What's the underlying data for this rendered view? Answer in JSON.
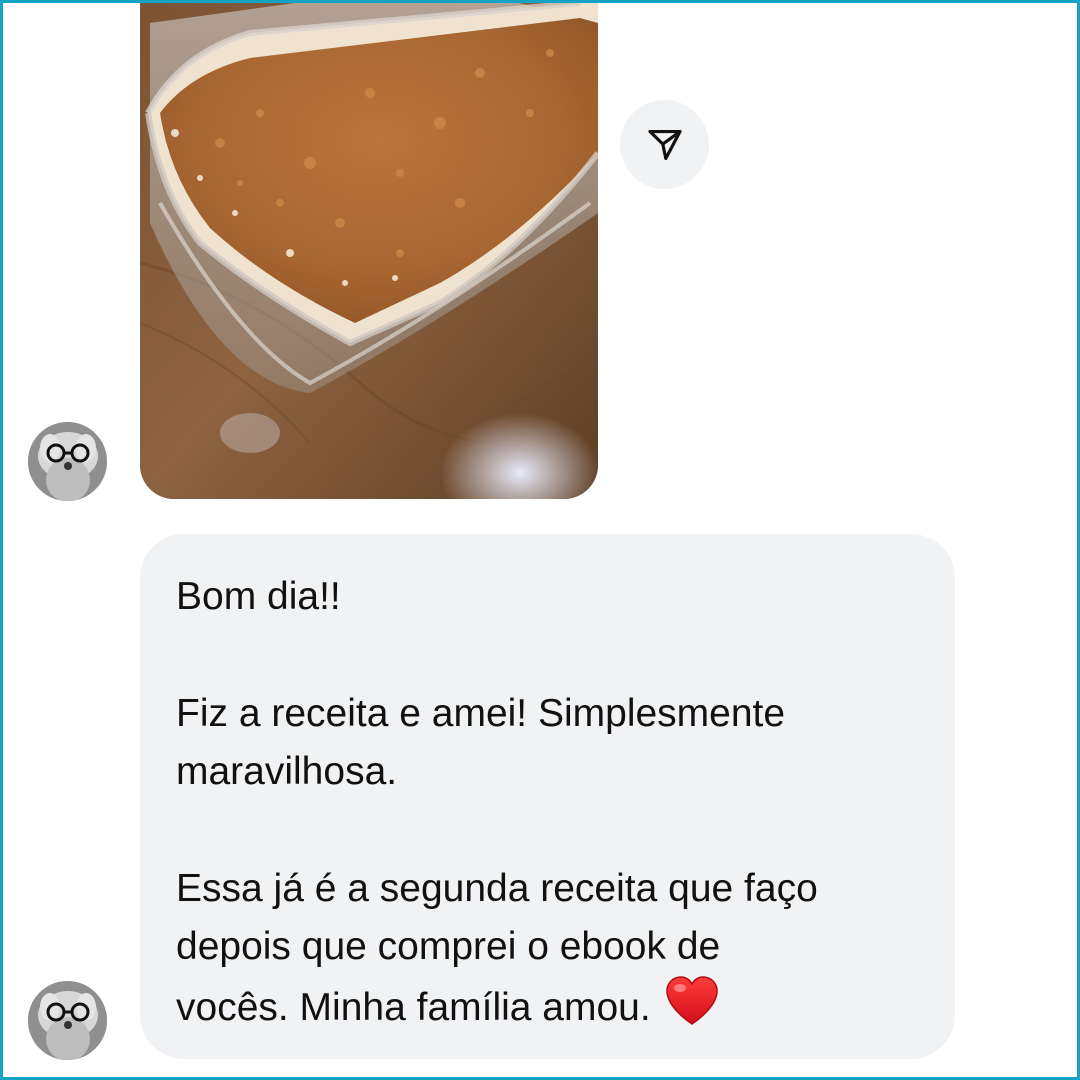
{
  "conversation": {
    "photo_message": {
      "icon": "food-photo"
    },
    "share_button": {
      "icon": "paper-plane-icon"
    },
    "sender_avatar": {
      "icon": "avatar-dog-with-glasses"
    },
    "text_message": {
      "lines": [
        "Bom dia!!",
        "",
        "Fiz a receita e amei! Simplesmente",
        "maravilhosa.",
        "",
        "Essa já é a segunda receita que faço",
        "depois que comprei o ebook de",
        "vocês. Minha família amou."
      ],
      "emoji": "❤️"
    }
  },
  "colors": {
    "frame_border": "#14a3c4",
    "bubble_background": "#f1f2f4",
    "text": "#111111",
    "heart": "#e0141e"
  }
}
